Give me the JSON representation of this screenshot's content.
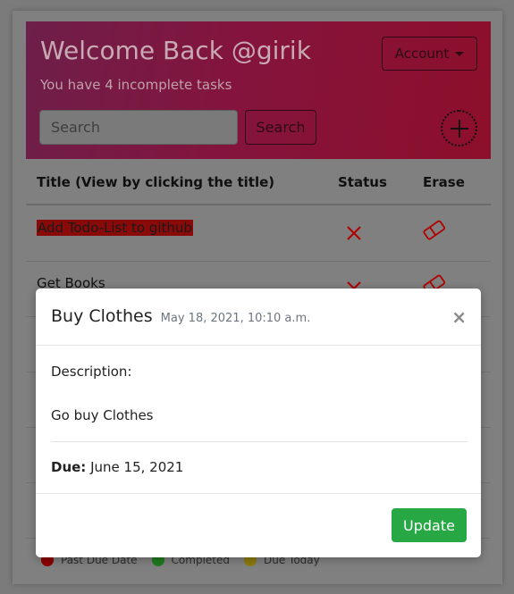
{
  "header": {
    "welcome": "Welcome Back @girik",
    "subtitle": "You have 4 incomplete tasks",
    "account_label": "Account",
    "search_placeholder": "Search",
    "search_button": "Search"
  },
  "table": {
    "col_title": "Title (View by clicking the title)",
    "col_status": "Status",
    "col_erase": "Erase",
    "rows": [
      {
        "title": "Add Todo-List to github",
        "status": "incomplete",
        "highlight": "past-due"
      },
      {
        "title": "Get Books",
        "status": "incomplete"
      }
    ]
  },
  "legend": [
    {
      "label": "Past Due Date",
      "color": "#8b0000"
    },
    {
      "label": "Completed",
      "color": "#1f7a1f"
    },
    {
      "label": "Due Today",
      "color": "#8a7a10"
    }
  ],
  "modal": {
    "title": "Buy Clothes",
    "date": "May 18, 2021, 10:10 a.m.",
    "close": "×",
    "description_label": "Description:",
    "description": "Go buy Clothes",
    "due_label": "Due:",
    "due_value": "June 15, 2021",
    "update_button": "Update"
  },
  "icons": {
    "status": "x-icon",
    "erase": "eraser-icon",
    "add": "plus-circle-icon"
  },
  "colors": {
    "header_gradient_start": "#6d1f4a",
    "header_gradient_end": "#8d0f2b",
    "status_x": "#b00000",
    "update_button": "#28a745"
  }
}
